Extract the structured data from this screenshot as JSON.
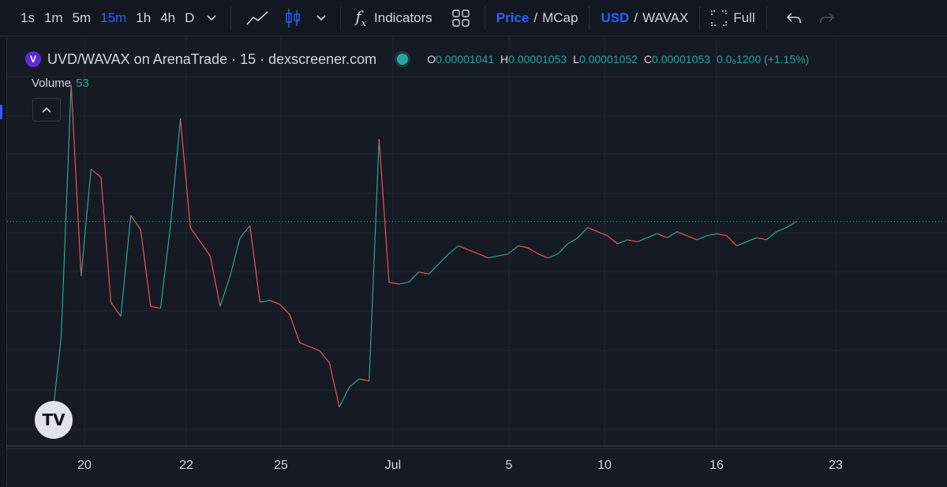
{
  "toolbar": {
    "intervals": [
      "1s",
      "1m",
      "5m",
      "15m",
      "1h",
      "4h",
      "D"
    ],
    "active_interval": "15m",
    "indicators_label": "Indicators",
    "price_label": "Price",
    "mcap_label": "MCap",
    "usd_label": "USD",
    "wavax_label": "WAVAX",
    "full_label": "Full",
    "icons": [
      "chevron-down-icon",
      "line-chart-icon",
      "candles-icon",
      "fx-icon",
      "layout-grid-icon",
      "fullscreen-icon",
      "undo-icon",
      "redo-icon"
    ]
  },
  "legend": {
    "title": "UVD/WAVAX on ArenaTrade · 15 · dexscreener.com",
    "open_label": "O",
    "open": "0.00001041",
    "high_label": "H",
    "high": "0.00001053",
    "low_label": "L",
    "low": "0.00001052",
    "close_label": "C",
    "close": "0.00001053",
    "change": "0.0₆1200 (+1.15%)",
    "volume_label": "Volume",
    "volume_value": "53"
  },
  "colors": {
    "up": "#26a69a",
    "down": "#ef5350",
    "accent": "#2962ff",
    "background": "#161a25"
  },
  "x_axis": {
    "ticks": [
      "20",
      "22",
      "25",
      "Jul",
      "5",
      "10",
      "16",
      "23"
    ]
  },
  "chart_data": {
    "type": "line",
    "title": "",
    "xlabel": "",
    "ylabel": "",
    "grid": true,
    "series": [
      {
        "values": [
          1e-06,
          5.5e-06,
          3.05e-05,
          8.5e-06,
          1.38e-05,
          1.34e-05,
          7.2e-06,
          6.5e-06,
          1.15e-05,
          1.08e-05,
          7e-06,
          6.9e-06,
          1.1e-05,
          1.63e-05,
          1.09e-05,
          1.02e-05,
          9.5e-06,
          7e-06,
          8.5e-06,
          1.04e-05,
          1.1e-05,
          7.2e-06,
          7.3e-06,
          7.1e-06,
          6.6e-06,
          5.2e-06,
          5e-06,
          4.8e-06,
          4.2e-06,
          2e-06,
          3e-06,
          3.4e-06,
          3.3e-06,
          1.53e-05,
          8.2e-06,
          8.1e-06,
          8.2e-06,
          8.7e-06,
          8.6e-06,
          9.1e-06,
          9.6e-06,
          1e-05,
          9.8e-06,
          9.6e-06,
          9.4e-06,
          9.5e-06,
          9.6e-06,
          1e-05,
          9.9e-06,
          9.6e-06,
          9.4e-06,
          9.6e-06,
          1.01e-05,
          1.04e-05,
          1.09e-05,
          1.07e-05,
          1.05e-05,
          1.01e-05,
          1.03e-05,
          1.02e-05,
          1.04e-05,
          1.06e-05,
          1.04e-05,
          1.07e-05,
          1.05e-05,
          1.03e-05,
          1.05e-05,
          1.06e-05,
          1.05e-05,
          1e-05,
          1.02e-05,
          1.04e-05,
          1.03e-05,
          1.07e-05,
          1.09e-05,
          1.12e-05
        ]
      }
    ]
  }
}
